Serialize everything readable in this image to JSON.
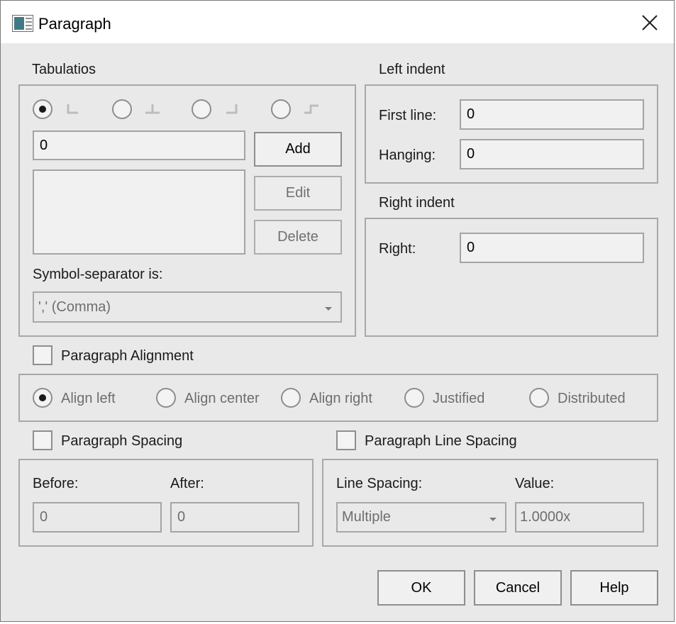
{
  "window": {
    "title": "Paragraph"
  },
  "tabs": {
    "label": "Tabulatios",
    "value": "0",
    "add": "Add",
    "edit": "Edit",
    "delete": "Delete",
    "separator_label": "Symbol-separator is:",
    "separator_value": "',' (Comma)"
  },
  "left_indent": {
    "label": "Left indent",
    "first_line_label": "First line:",
    "first_line_value": "0",
    "hanging_label": "Hanging:",
    "hanging_value": "0"
  },
  "right_indent": {
    "label": "Right indent",
    "right_label": "Right:",
    "right_value": "0"
  },
  "alignment": {
    "label": "Paragraph Alignment",
    "options": [
      "Align left",
      "Align center",
      "Align right",
      "Justified",
      "Distributed"
    ],
    "selected": "Align left"
  },
  "spacing": {
    "label": "Paragraph Spacing",
    "before_label": "Before:",
    "before_value": "0",
    "after_label": "After:",
    "after_value": "0"
  },
  "line_spacing": {
    "label": "Paragraph Line Spacing",
    "line_label": "Line Spacing:",
    "line_value": "Multiple",
    "value_label": "Value:",
    "value": "1.0000x"
  },
  "footer": {
    "ok": "OK",
    "cancel": "Cancel",
    "help": "Help"
  }
}
